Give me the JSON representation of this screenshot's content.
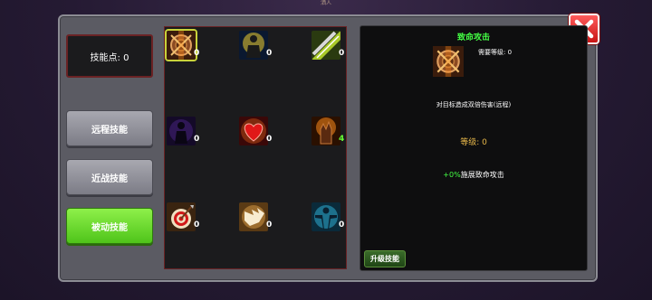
{
  "top_label": "洒人",
  "skill_points": "技能点: 0",
  "categories": [
    {
      "label": "远程技能",
      "active": false
    },
    {
      "label": "近战技能",
      "active": false
    },
    {
      "label": "被动技能",
      "active": true
    }
  ],
  "skills": [
    {
      "icon": "crossed-swords-shield-icon",
      "level": "0",
      "selected": true
    },
    {
      "icon": "glowing-warrior-icon",
      "level": "0"
    },
    {
      "icon": "blade-strike-icon",
      "level": "0"
    },
    {
      "icon": "shadow-figure-icon",
      "level": "0"
    },
    {
      "icon": "heart-icon",
      "level": "0"
    },
    {
      "icon": "fire-fist-icon",
      "level": "4",
      "level_color": "#66ff33"
    },
    {
      "icon": "target-arrow-icon",
      "level": "0"
    },
    {
      "icon": "winged-boot-icon",
      "level": "0"
    },
    {
      "icon": "aura-figure-icon",
      "level": "0"
    }
  ],
  "detail": {
    "title": "致命攻击",
    "required_level": "需要等级: 0",
    "description": "对目标造成双倍伤害(远程)",
    "level": "等级: 0",
    "effect_percent": "+0%",
    "effect_text": "施展致命攻击"
  },
  "upgrade_label": "升级技能",
  "colors": {
    "title_green": "#44ff44",
    "level_gold": "#e8b84a",
    "active_tab": "#6ad630",
    "close_red": "#e02424"
  }
}
